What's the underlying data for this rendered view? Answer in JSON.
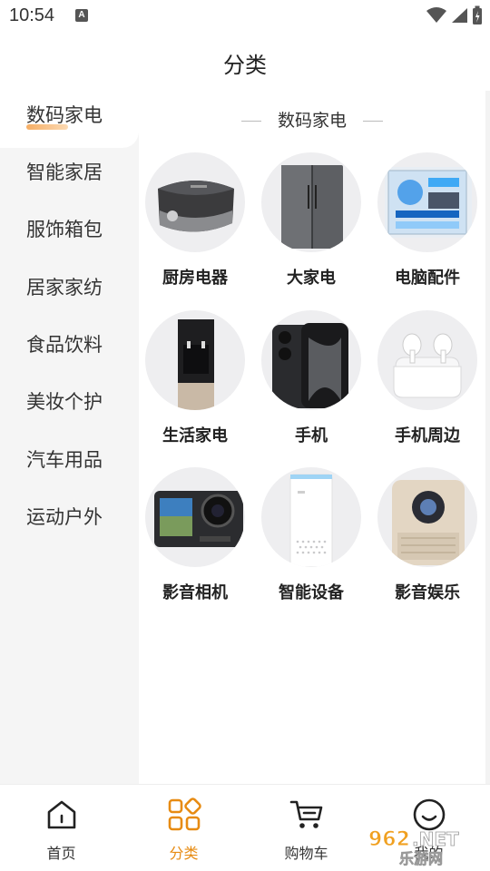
{
  "status": {
    "time": "10:54",
    "notif_glyph": "A"
  },
  "header": {
    "title": "分类"
  },
  "sidebar": {
    "items": [
      {
        "label": "数码家电",
        "active": true
      },
      {
        "label": "智能家居",
        "active": false
      },
      {
        "label": "服饰箱包",
        "active": false
      },
      {
        "label": "居家家纺",
        "active": false
      },
      {
        "label": "食品饮料",
        "active": false
      },
      {
        "label": "美妆个护",
        "active": false
      },
      {
        "label": "汽车用品",
        "active": false
      },
      {
        "label": "运动户外",
        "active": false
      }
    ]
  },
  "content": {
    "heading": "数码家电",
    "items": [
      {
        "label": "厨房电器",
        "icon": "rice-cooker-icon"
      },
      {
        "label": "大家电",
        "icon": "refrigerator-icon"
      },
      {
        "label": "电脑配件",
        "icon": "pc-case-icon"
      },
      {
        "label": "生活家电",
        "icon": "water-dispenser-icon"
      },
      {
        "label": "手机",
        "icon": "smartphone-icon"
      },
      {
        "label": "手机周边",
        "icon": "earbuds-icon"
      },
      {
        "label": "影音相机",
        "icon": "action-camera-icon"
      },
      {
        "label": "智能设备",
        "icon": "smart-speaker-icon"
      },
      {
        "label": "影音娱乐",
        "icon": "projector-icon"
      }
    ]
  },
  "bottom_nav": {
    "items": [
      {
        "label": "首页",
        "icon": "home-icon",
        "active": false
      },
      {
        "label": "分类",
        "icon": "category-grid-icon",
        "active": true
      },
      {
        "label": "购物车",
        "icon": "cart-icon",
        "active": false
      },
      {
        "label": "我的",
        "icon": "profile-icon",
        "active": false
      }
    ]
  },
  "watermark": {
    "text_top": "962.NET",
    "text_bottom": "乐游网"
  },
  "colors": {
    "accent": "#e78b12",
    "sidebar_bg": "#f5f5f5",
    "circle_bg": "#eeeef0"
  }
}
